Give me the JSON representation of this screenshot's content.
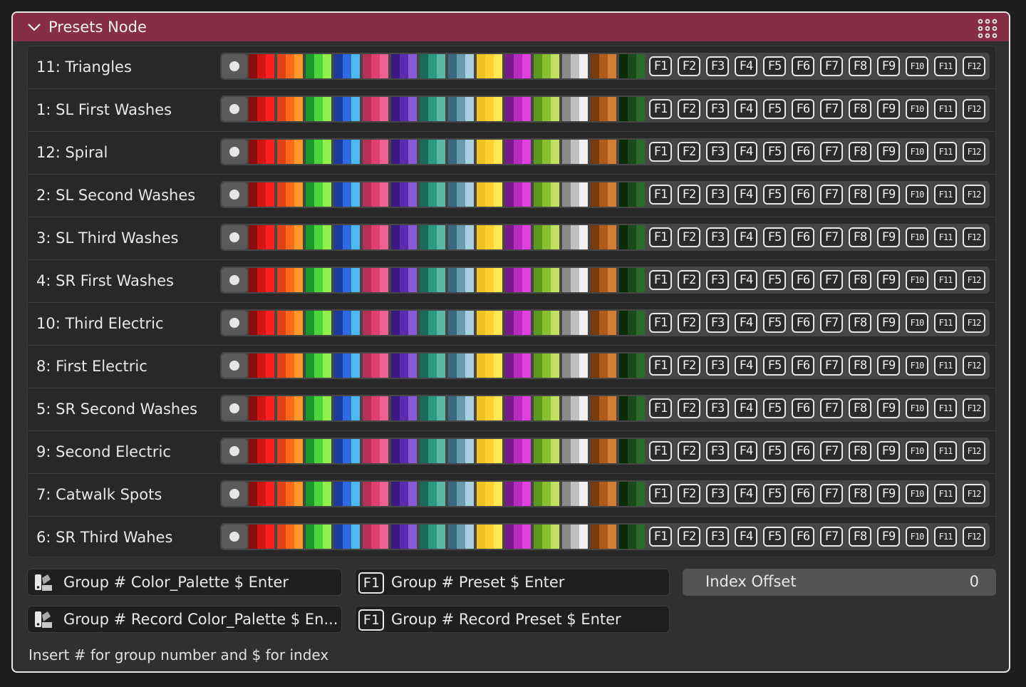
{
  "node": {
    "title": "Presets Node",
    "header_color": "#872e47"
  },
  "swatch_colors": [
    [
      "#8a0c0c",
      "#d11616",
      "#ff1e1e"
    ],
    [
      "#e0401a",
      "#ff6a1a",
      "#ff9a2a"
    ],
    [
      "#1a9a2a",
      "#4cd43a",
      "#8ef04a"
    ],
    [
      "#1a3aa0",
      "#2c6ae0",
      "#50b8f0"
    ],
    [
      "#b8305a",
      "#e04070",
      "#f06090"
    ],
    [
      "#3a1a80",
      "#5a2ab0",
      "#8a5ad8"
    ],
    [
      "#1a6a5a",
      "#2a9a80",
      "#5ab8a8"
    ],
    [
      "#3a6a80",
      "#6a9ab0",
      "#a8d0e0"
    ],
    [
      "#f0c020",
      "#ffd030",
      "#ffe850"
    ],
    [
      "#7a1a8a",
      "#b82ac0",
      "#e040e0"
    ],
    [
      "#5a9a1a",
      "#8ac030",
      "#c0e060"
    ],
    [
      "#8a8a8a",
      "#c0c0c0",
      "#f0f0f0"
    ],
    [
      "#7a3a10",
      "#b05a1a",
      "#d08030"
    ],
    [
      "#0a2a0a",
      "#1a4a1a",
      "#2a6a2a"
    ]
  ],
  "fkeys": [
    "F1",
    "F2",
    "F3",
    "F4",
    "F5",
    "F6",
    "F7",
    "F8",
    "F9",
    "F10",
    "F11",
    "F12"
  ],
  "presets": [
    {
      "label": "11: Triangles"
    },
    {
      "label": "1: SL First Washes"
    },
    {
      "label": "12: Spiral"
    },
    {
      "label": "2: SL Second Washes"
    },
    {
      "label": "3: SL Third Washes"
    },
    {
      "label": "4: SR First Washes"
    },
    {
      "label": "10: Third Electric"
    },
    {
      "label": "8: First Electric"
    },
    {
      "label": "5: SR Second Washes"
    },
    {
      "label": "9: Second Electric"
    },
    {
      "label": "7: Catwalk Spots"
    },
    {
      "label": "6: SR Third Wahes"
    }
  ],
  "fields": {
    "color_palette": "Group # Color_Palette $ Enter",
    "preset": "Group # Preset $ Enter",
    "record_color_palette": "Group # Record Color_Palette $ En...",
    "record_preset": "Group # Record Preset $ Enter",
    "f1_icon_label": "F1"
  },
  "index_offset": {
    "label": "Index Offset",
    "value": "0"
  },
  "hint": "Insert # for group number and $ for index"
}
